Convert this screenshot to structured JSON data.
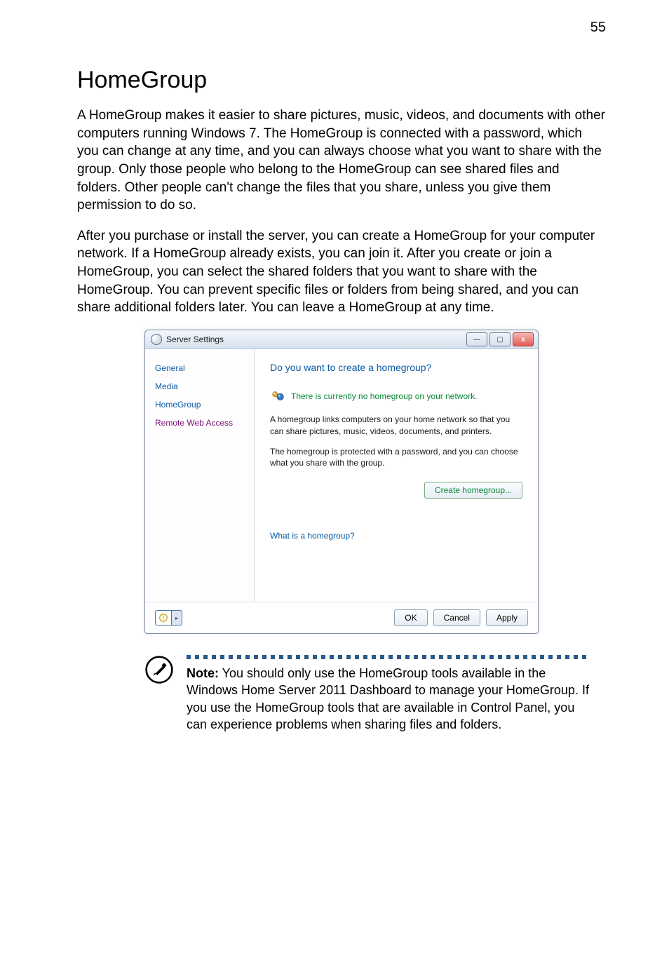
{
  "page_number": "55",
  "heading": "HomeGroup",
  "para1": "A HomeGroup makes it easier to share pictures, music, videos, and documents with other computers running Windows 7. The HomeGroup is connected with a password, which you can change at any time, and you can always choose what you want to share with the group. Only those people who belong to the HomeGroup can see shared files and folders. Other people can't change the files that you share, unless you give them permission to do so.",
  "para2": "After you purchase or install the server, you can create a HomeGroup for your computer network. If a HomeGroup already exists, you can join it. After you create or join a HomeGroup, you can select the shared folders that you want to share with the HomeGroup. You can prevent specific files or folders from being shared, and you can share additional folders later. You can leave a HomeGroup at any time.",
  "dialog": {
    "title": "Server Settings",
    "sidebar": {
      "items": [
        "General",
        "Media",
        "HomeGroup",
        "Remote Web Access"
      ],
      "selected_index": 3
    },
    "headline": "Do you want to create a homegroup?",
    "status": "There is currently no homegroup on your network.",
    "desc_line": "A homegroup links computers on your home network so that you can share pictures, music, videos, documents, and printers.",
    "protect_line": "The homegroup is protected with a password, and you can choose what you share with the group.",
    "create_label": "Create homegroup...",
    "help_link": "What is a homegroup?",
    "footer": {
      "ok": "OK",
      "cancel": "Cancel",
      "apply": "Apply"
    },
    "winbtns": {
      "min": "—",
      "max": "▢",
      "close": "x"
    },
    "info_glyph": "⓪",
    "info_arrow": "▸"
  },
  "note": {
    "label": "Note:",
    "text": " You should only use the HomeGroup tools available in the Windows Home Server 2011 Dashboard to manage your HomeGroup. If you use the HomeGroup tools that are available in Control Panel, you can experience problems when sharing files and folders."
  }
}
